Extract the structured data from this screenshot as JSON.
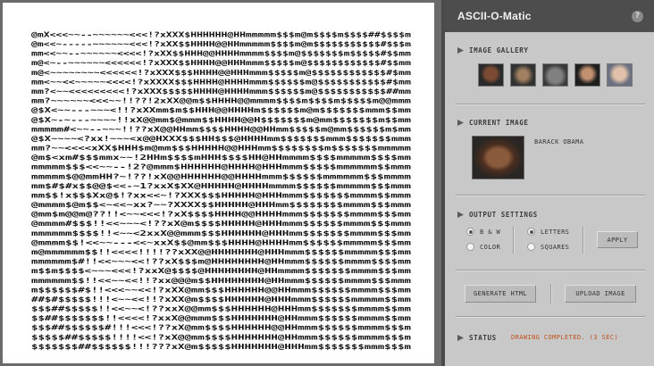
{
  "app": {
    "title": "ASCII-O-Matic",
    "help_glyph": "?"
  },
  "sections": {
    "gallery": "IMAGE GALLERY",
    "current": "CURRENT IMAGE",
    "output": "OUTPUT SETTINGS",
    "status": "STATUS"
  },
  "gallery": {
    "thumbnail_count": 5
  },
  "current_image": {
    "name": "BARACK OBAMA"
  },
  "output_settings": {
    "options": [
      "B & W",
      "COLOR",
      "LETTERS",
      "SQUARES"
    ],
    "selected": [
      "B & W",
      "LETTERS"
    ],
    "apply_label": "APPLY"
  },
  "actions": {
    "generate_label": "GENERATE HTML",
    "upload_label": "UPLOAD IMAGE"
  },
  "status": {
    "text": "DRAWING COMPLETED. (3 SEC)"
  },
  "colors": {
    "status_text": "#c0501a",
    "titlebar": "#4d4d4d",
    "panel": "#c8c8c8"
  },
  "ascii_rows": [
    "@mX<<<~~--~~~~~~<<<!?xXXX$HHHHHH@HHmmmmm$$$m@m$$$$m$$$$##$$$$m",
    "@m<<~-----~~~~~~<<<!?xXX$$HHHH@@HHmmmmm$$$$m@m$$$$$$$$$$$#$$$m",
    "mm<<~~--~~~~~~<<<<!?xXX$$HHH@@HHHHmmmm$$$$m@$$$$$$$m$$$$$#$$mm",
    "m@<~--~~~~~~<<<<<<!?xXXX$$HHHH@@HHHmmm$$$$$m@$$$$$$$$$$$$#$$mm",
    "m@<~~~~~~~~<<<<<<!?xXXX$$$HHHH@@HHHmmm$$$$$m@$$$$$$$$$$$$#$mm",
    "mm<~~<<~~~~~<<<<!?xXXXX$$$HHHH@HHHHmmm$$$$$$m@$$$$$$$$$$$#$mm",
    "mm?<~~<<<<<<<<<!?xXXX$$$$$HHHH@HHHHmmm$$$$$$m@$$$$$$$$$$$##mm",
    "mm?~~~~~~<<<~~!!??!2xXX@@m$$HHHH@@mmmm$$$$m$$$$m$$$$$m@@mmm",
    "@$X<~~---~~~<!!?xXXmm$m$$HHH@@HHHHm$$$$$$m@m$$$$$$$mmm$$mm",
    "@$X~-~---~~~~!!xX@@mm$@mmm$$HHHH@@H$$$$$$$m@mm$$$$$$$m$$mm",
    "mmmmm#<~~--~~~!!??xX@@HHmm$$$$HHHH@@HHmm$$$$$m@mm$$$$$$m$mm",
    "@$X~~~~<?xx!~~~<x@@HXXX$$$HH$$$@HHHHmm$$$$$$$mmm$$$$$$$mmm",
    "mm?~~<<<<xXX$HHH$m@mm$$$HHHHH@@HHHmm$$$$$$$$m$$$$$$$mmmmm",
    "@m$<xm#$$$mmx~~!2HHm$$$$mHHH$$$$HH@HHmmmm$$$$mmmmm$$$$mm",
    "mmmmm$$$<<~~--!2?@mmm$HHHHHH@HHHH@HHHmmm$$$$$mmmmmm$$mmm",
    "mmmmm$@@mmHH?~!??!xX@@HHHHHH@@HHHHmmm$$$$$$mmmmmm$$$mmmm",
    "mm$#$#x$$@@$<<-~1?xxX$XX@HHHHH@HHHHmmmm$$$$$$mmmmm$$$mmm",
    "mm$$!x$$$Xx@$!?xx<<~!?XXX$$$HHHHH@HHHmmm$$$$$$$mmmm$$mmm",
    "@mmmm$@m$$<~<<~xx?~~?XXXX$$HHHHH@HHHmm$$$$$$$$mmmm$$$mmm",
    "@mm$m@@m@??!!<~~<<<!?xX$$$$HHHH@@HHHHmmm$$$$$$$mmmm$$$mm",
    "@mmmm#$$$!!<<~~~<!??xX@m$$$$HHHHH@HHHmmm$$$$$$mmmm$$$mmm",
    "mmmmmm$$$$!!<~~<2xxX@@mmm$$$HHHHHH@HHHmm$$$$$$$mmmm$$$mm",
    "@mmmm$$!<<~~---<<~xxX$$@mm$$$HHHH@HHHHmm$$$$$$mmmmm$$$mm",
    "m@mmmmmm$$!!<<<<!!!!??xXX@@HHHHHHH@HHHmmm$$$$$$mmmmm$$$mm",
    "mmmmmm$#!!<<~~~<<!??xX$$$m@HHHHHHHH@HHmmm$$$$$$mmmm$$$$mm",
    "m$$m$$$$<~~~<<<!?xxX@$$$$@HHHHHHHH@HHmmmm$$$$$$$mmmm$$$mm",
    "mmmmmm$$!!<<~~<<!!?xx@@@m$$HHHHHHHH@HHmmm$$$$$$mmmm$$$mmm",
    "m$$$$$$#$!!<<<~~<<!?xXX@mm$$$HHHHHH@@HHmmm$$$$$$mmmm$$$mm",
    "##$#$$$$$!!!<~~<<!!?xXX@m$$$$HHHHHH@HHHmmm$$$$$$mmmmm$$mm",
    "$$$##$$$$$!!<<~~<!??xxX@@mm$$$HHHHHH@HHHmm$$$$$$$mmmm$$mm",
    "$$##$$$$$$$!!<<<<!?xxX@@mmm$$$HHHHHHH@HHmmm$$$$$$mmmm$$mm",
    "$$$##$$$$$$#!!!<<<!??xX@mm$$$$HHHHHH@@HHmmm$$$$$$mmmm$$$m",
    "$$$$$##$$$$$!!!!<<!?xX@@mm$$$$HHHHHHH@HHmmm$$$$$$mmmm$$$m",
    "$$$$$$$##$$$$$$!!!???xX@m$$$$$HHHHHHH@HHHmm$$$$$$$mmm$$$m"
  ]
}
